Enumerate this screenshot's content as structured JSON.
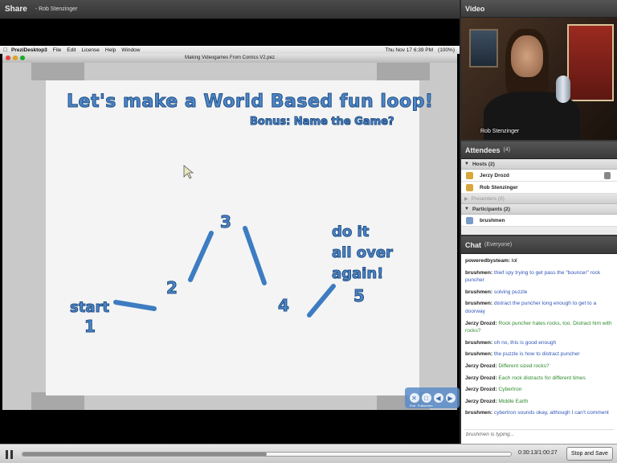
{
  "share": {
    "title": "Share",
    "presenter": "- Rob Stenzinger"
  },
  "mac": {
    "app_name": "PreziDesktop3",
    "menus": [
      "File",
      "Edit",
      "License",
      "Help",
      "Window"
    ],
    "clock": "Thu Nov 17  6:39 PM",
    "battery": "(100%)",
    "window_title": "Making Videogames From Comics V2.pez"
  },
  "slide": {
    "title": "Let's make a World Based fun loop!",
    "bonus": "Bonus: Name the Game?",
    "start": "start",
    "n1": "1",
    "n2": "2",
    "n3": "3",
    "n4": "4",
    "n5": "5",
    "do_line1": "do it",
    "do_line2": "all over",
    "do_line3": "again!"
  },
  "prezi_controls": {
    "end_label": "End",
    "fullscreen_label": "Fullscreen"
  },
  "video": {
    "title": "Video",
    "name": "Rob Stenzinger"
  },
  "attendees": {
    "title": "Attendees",
    "count": "(4)",
    "hosts_label": "Hosts (2)",
    "hosts": [
      "Jerzy Drozd",
      "Rob Stenzinger"
    ],
    "presenters_label": "Presenters (0)",
    "participants_label": "Participants (2)",
    "participants": [
      "brushmen"
    ]
  },
  "chat": {
    "title": "Chat",
    "scope": "(Everyone)",
    "messages": [
      {
        "who": "poweredbysteam:",
        "text": " lol",
        "color": "plain"
      },
      {
        "who": "brushmen:",
        "text": " thief spy trying to get pass the \"bouncer\" rock puncher",
        "color": "blue"
      },
      {
        "who": "brushmen:",
        "text": " solving puzzle",
        "color": "blue"
      },
      {
        "who": "brushmen:",
        "text": " distract the puncher long enough to get to a doorway",
        "color": "blue"
      },
      {
        "who": "Jerzy Drozd:",
        "text": " Rock puncher hates rocks, too. Distract him with rocks?",
        "color": "green"
      },
      {
        "who": "brushmen:",
        "text": " oh no, this is good enough",
        "color": "blue"
      },
      {
        "who": "brushmen:",
        "text": " the puzzle is how to distract puncher",
        "color": "blue"
      },
      {
        "who": "Jerzy Drozd:",
        "text": " Different sized rocks?",
        "color": "green"
      },
      {
        "who": "Jerzy Drozd:",
        "text": " Each rock distracts for different times",
        "color": "green"
      },
      {
        "who": "Jerzy Drozd:",
        "text": " Cybertron",
        "color": "green"
      },
      {
        "who": "Jerzy Drozd:",
        "text": " Middle Earth",
        "color": "green"
      },
      {
        "who": "brushmen:",
        "text": " cybertron sounds okay, although I can't comment",
        "color": "blue"
      }
    ],
    "typing": "brushmen is typing..."
  },
  "playback": {
    "time": "0:30:13/1:00:27",
    "progress": 0.5,
    "stop_label": "Stop and Save"
  }
}
